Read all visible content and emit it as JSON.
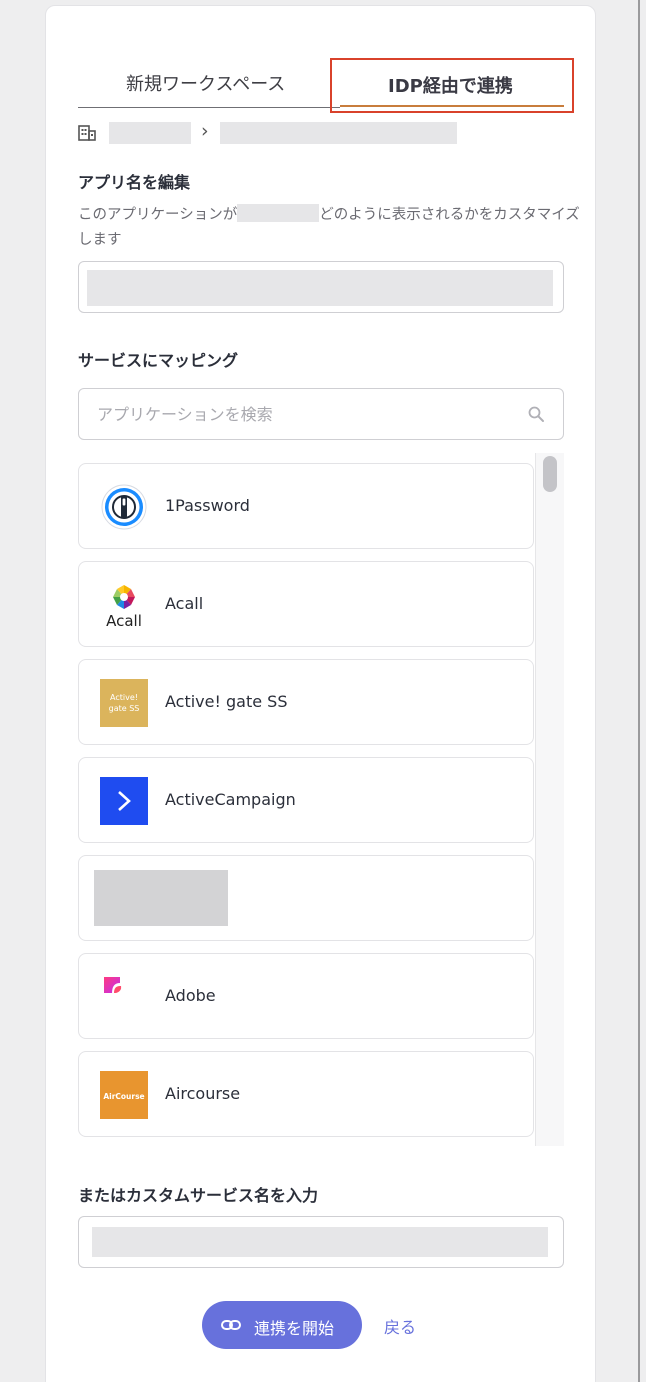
{
  "tabs": [
    {
      "label": "新規ワークスペース",
      "active": false
    },
    {
      "label": "IDP経由で連携",
      "active": true
    }
  ],
  "accent_color": "#6771dc",
  "highlight_color": "#d9422b",
  "app_name_section": {
    "title": "アプリ名を編集",
    "desc_prefix": "このアプリケーションが",
    "desc_suffix": "どのように表示されるかをカスタマイズします"
  },
  "mapping_section": {
    "title": "サービスにマッピング",
    "search_placeholder": "アプリケーションを検索"
  },
  "apps": [
    {
      "name": "1Password",
      "icon": "1password-logo"
    },
    {
      "name": "Acall",
      "icon": "acall-logo",
      "logo_text": "Acall"
    },
    {
      "name": "Active! gate SS",
      "icon": "active-gate-logo",
      "logo_text_1": "Active!",
      "logo_text_2": "gate SS"
    },
    {
      "name": "ActiveCampaign",
      "icon": "activecampaign-logo"
    },
    {
      "name": "",
      "icon": "redacted-logo"
    },
    {
      "name": "Adobe",
      "icon": "adobe-logo"
    },
    {
      "name": "Aircourse",
      "icon": "aircourse-logo",
      "logo_text": "AirCourse"
    }
  ],
  "custom_section": {
    "title": "またはカスタムサービス名を入力"
  },
  "actions": {
    "start_label": "連携を開始",
    "back_label": "戻る"
  }
}
